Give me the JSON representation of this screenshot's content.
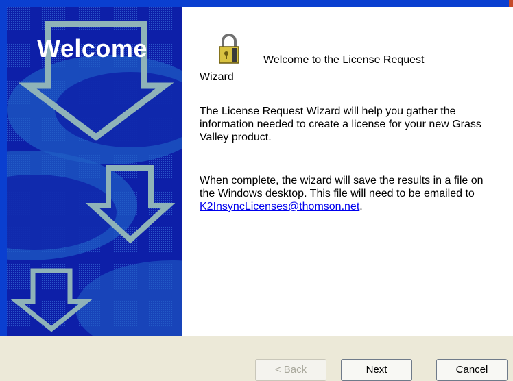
{
  "sidebar": {
    "title": "Welcome"
  },
  "content": {
    "icon": "lock-key-icon",
    "welcome_line_a": "Welcome to the License Request",
    "welcome_line_b": "Wizard",
    "para1": "The License Request Wizard will help you gather the information needed to create a license for your new Grass Valley product.",
    "para2_text": "When complete, the wizard will save the results in a file on the Windows desktop. This file will need to be emailed to",
    "email": "K2InsyncLicenses@thomson.net",
    "email_suffix": "."
  },
  "buttons": {
    "back": "< Back",
    "next": "Next",
    "cancel": "Cancel"
  },
  "colors": {
    "window_frame": "#0a3fd0",
    "sidebar_bg": "#0d1fa8",
    "arrow_outline": "#8fb3b8",
    "link": "#0000ee",
    "dialog_bg": "#ece9d8"
  }
}
